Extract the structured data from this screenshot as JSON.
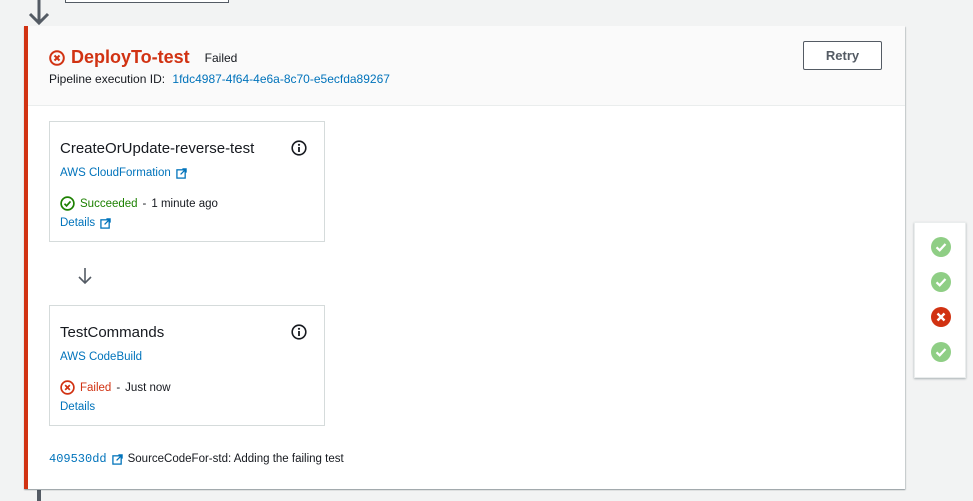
{
  "stage": {
    "title": "DeployTo-test",
    "status": "Failed",
    "execution_label": "Pipeline execution ID:",
    "execution_id": "1fdc4987-4f64-4e6a-8c70-e5ecfda89267",
    "retry_label": "Retry",
    "accent_color": "#d13212"
  },
  "actions": [
    {
      "title": "CreateOrUpdate-reverse-test",
      "provider": "AWS CloudFormation",
      "status": "Succeeded",
      "separator": "-",
      "time": "1 minute ago",
      "details": "Details",
      "status_icon": "check-circle-icon"
    },
    {
      "title": "TestCommands",
      "provider": "AWS CodeBuild",
      "status": "Failed",
      "separator": "-",
      "time": "Just now",
      "details": "Details",
      "status_icon": "x-circle-icon"
    }
  ],
  "commit": {
    "id": "409530dd",
    "message": "SourceCodeFor-std: Adding the failing test"
  },
  "side_panel": {
    "icons": [
      "check-circle-filled-icon",
      "check-circle-filled-icon",
      "x-circle-filled-icon",
      "check-circle-filled-icon"
    ]
  },
  "colors": {
    "success": "#1d8102",
    "error": "#d13212",
    "link": "#0073bb",
    "success_light": "#8fce85"
  }
}
